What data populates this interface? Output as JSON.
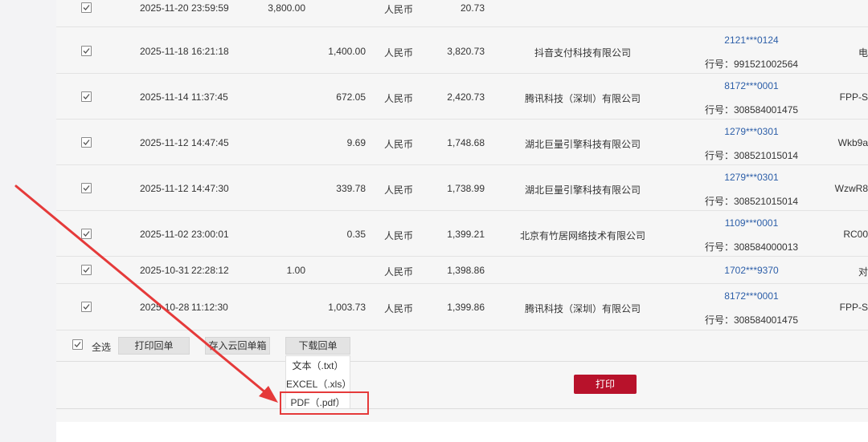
{
  "rows": [
    {
      "date": "2025-11-20",
      "time": "23:59:59",
      "expense": "",
      "income": "3,800.00",
      "currency": "人民币",
      "balance": "20.73",
      "counterparty": "",
      "account": "",
      "bank_no": "",
      "extra": ""
    },
    {
      "date": "2025-11-18",
      "time": "16:21:18",
      "expense": "1,400.00",
      "income": "",
      "currency": "人民币",
      "balance": "3,820.73",
      "counterparty": "抖音支付科技有限公司",
      "account": "2121***0124",
      "bank_no": "行号：991521002564",
      "extra": "电"
    },
    {
      "date": "2025-11-14",
      "time": "11:37:45",
      "expense": "672.05",
      "income": "",
      "currency": "人民币",
      "balance": "2,420.73",
      "counterparty": "腾讯科技（深圳）有限公司",
      "account": "8172***0001",
      "bank_no": "行号：308584001475",
      "extra": "FPP-S"
    },
    {
      "date": "2025-11-12",
      "time": "14:47:45",
      "expense": "9.69",
      "income": "",
      "currency": "人民币",
      "balance": "1,748.68",
      "counterparty": "湖北巨量引擎科技有限公司",
      "account": "1279***0301",
      "bank_no": "行号：308521015014",
      "extra": "Wkb9a"
    },
    {
      "date": "2025-11-12",
      "time": "14:47:30",
      "expense": "339.78",
      "income": "",
      "currency": "人民币",
      "balance": "1,738.99",
      "counterparty": "湖北巨量引擎科技有限公司",
      "account": "1279***0301",
      "bank_no": "行号：308521015014",
      "extra": "WzwR8"
    },
    {
      "date": "2025-11-02",
      "time": "23:00:01",
      "expense": "0.35",
      "income": "",
      "currency": "人民币",
      "balance": "1,399.21",
      "counterparty": "北京有竹居网络技术有限公司",
      "account": "1109***0001",
      "bank_no": "行号：308584000013",
      "extra": "RC00"
    },
    {
      "date": "2025-10-31",
      "time": "22:28:12",
      "expense": "",
      "income": "1.00",
      "currency": "人民币",
      "balance": "1,398.86",
      "counterparty": "",
      "account": "1702***9370",
      "bank_no": "",
      "extra": "对"
    },
    {
      "date": "2025-10-28",
      "time": "11:12:30",
      "expense": "1,003.73",
      "income": "",
      "currency": "人民币",
      "balance": "1,399.86",
      "counterparty": "腾讯科技（深圳）有限公司",
      "account": "8172***0001",
      "bank_no": "行号：308584001475",
      "extra": "FPP-S"
    }
  ],
  "footer": {
    "select_all": "全选",
    "print_receipt": "打印回单",
    "save_cloud": "存入云回单箱",
    "download_receipt": "下载回单",
    "print": "打印"
  },
  "dropdown": {
    "items": [
      "文本（.txt）",
      "EXCEL（.xls）",
      "PDF（.pdf）"
    ]
  },
  "colors": {
    "accent": "#b8122b",
    "link": "#2c5ea8",
    "annotation": "#e53a3a"
  }
}
